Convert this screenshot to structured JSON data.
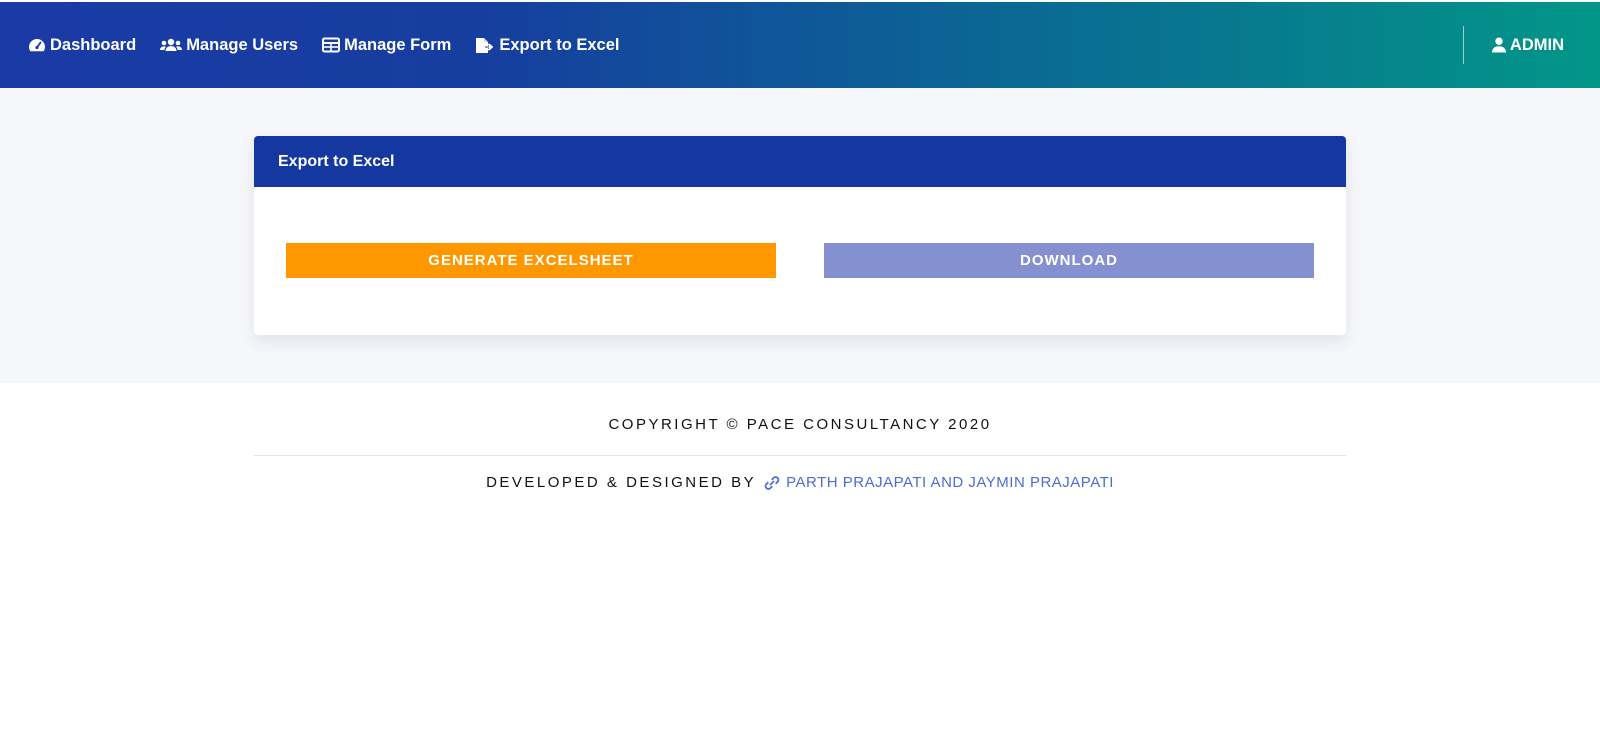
{
  "nav": {
    "items": [
      {
        "label": "Dashboard",
        "icon": "tachometer-icon"
      },
      {
        "label": "Manage Users",
        "icon": "users-icon"
      },
      {
        "label": "Manage Form",
        "icon": "table-icon"
      },
      {
        "label": "Export to Excel",
        "icon": "file-export-icon"
      }
    ],
    "user_label": "ADMIN"
  },
  "card": {
    "title": "Export to Excel",
    "generate_label": "GENERATE EXCELSHEET",
    "download_label": "DOWNLOAD"
  },
  "footer": {
    "copyright": "COPYRIGHT © PACE CONSULTANCY 2020",
    "developed_prefix": "DEVELOPED & DESIGNED BY",
    "developers": "PARTH PRAJAPATI AND JAYMIN PRAJAPATI"
  },
  "colors": {
    "nav_gradient_start": "#1a3aa6",
    "nav_gradient_end": "#029688",
    "card_header": "#1437a0",
    "generate_button": "#ff9800",
    "download_button": "#8590d1",
    "link": "#4e6bd9"
  }
}
